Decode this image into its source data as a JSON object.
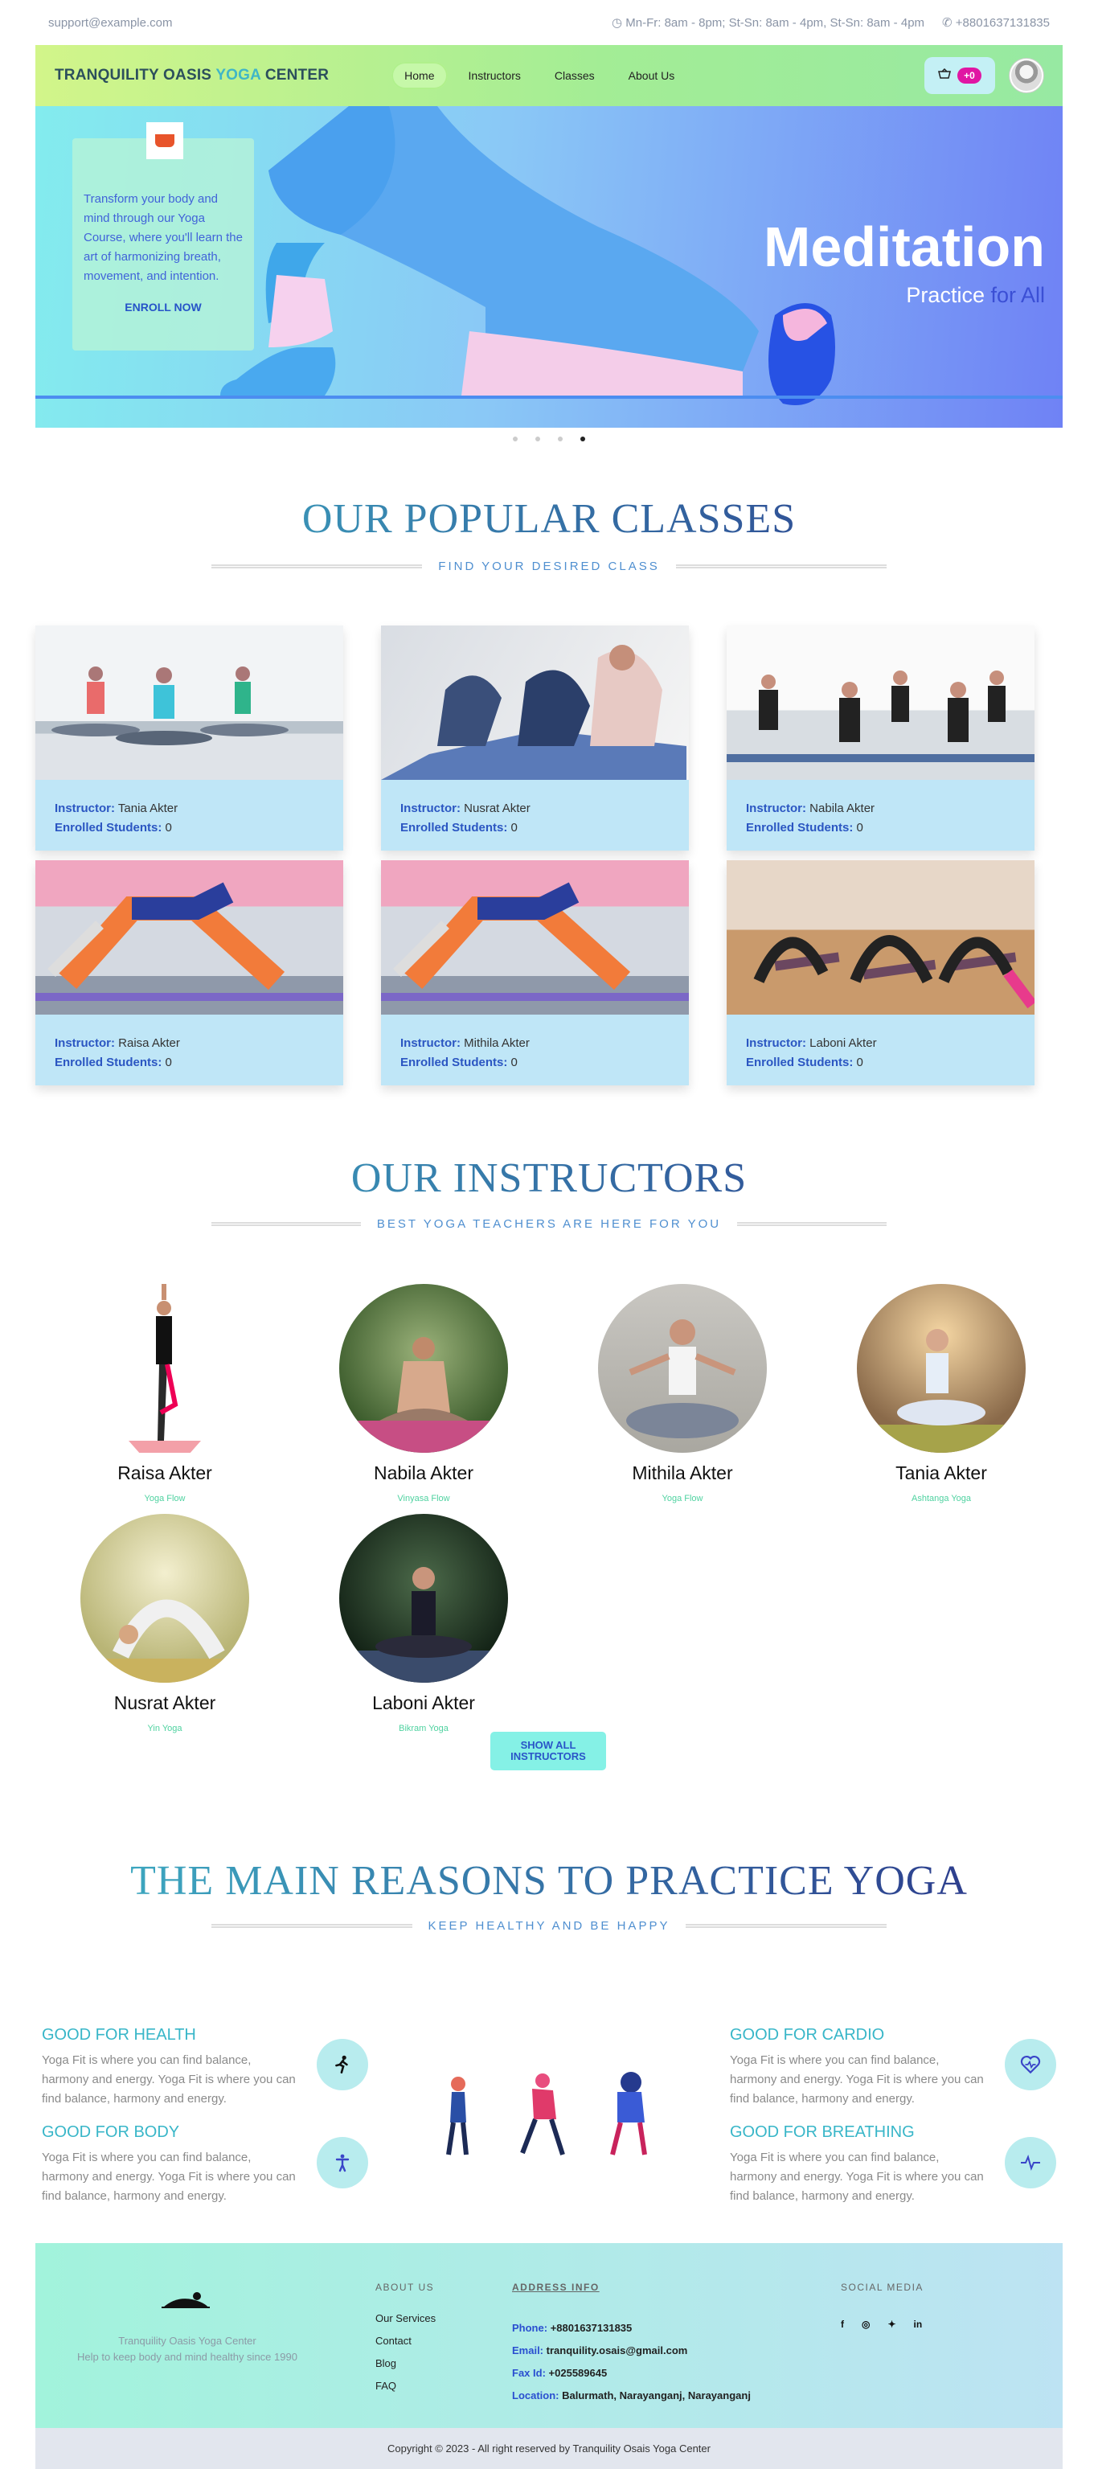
{
  "topbar": {
    "email": "support@example.com",
    "hours": "Mn-Fr: 8am - 8pm; St-Sn: 8am - 4pm, St-Sn: 8am - 4pm",
    "phone": "+8801637131835"
  },
  "nav": {
    "brand_1": "TRANQUILITY OASIS ",
    "brand_2": "YOGA",
    "brand_3": " CENTER",
    "items": [
      "Home",
      "Instructors",
      "Classes",
      "About Us"
    ],
    "cart_count": "+0"
  },
  "hero": {
    "text": "Transform your body and mind through our Yoga Course, where you'll learn the art of harmonizing breath, movement, and intention.",
    "cta": "ENROLL NOW",
    "title": "Meditation",
    "sub1": "Practice ",
    "sub2": "for All"
  },
  "classes": {
    "title": "OUR POPULAR CLASSES",
    "subtitle": "FIND YOUR DESIRED CLASS",
    "instructor_label": "Instructor:",
    "enrolled_label": "Enrolled Students:",
    "items": [
      {
        "instructor": "Tania Akter",
        "enrolled": "0"
      },
      {
        "instructor": "Nusrat Akter",
        "enrolled": "0"
      },
      {
        "instructor": "Nabila Akter",
        "enrolled": "0"
      },
      {
        "instructor": "Raisa Akter",
        "enrolled": "0"
      },
      {
        "instructor": "Mithila Akter",
        "enrolled": "0"
      },
      {
        "instructor": "Laboni Akter",
        "enrolled": "0"
      }
    ]
  },
  "instructors": {
    "title": "OUR INSTRUCTORS",
    "subtitle": "BEST YOGA TEACHERS ARE HERE FOR YOU",
    "show_all": "SHOW ALL INSTRUCTORS",
    "items": [
      {
        "name": "Raisa Akter",
        "style": "Yoga Flow"
      },
      {
        "name": "Nabila Akter",
        "style": "Vinyasa Flow"
      },
      {
        "name": "Mithila Akter",
        "style": "Yoga Flow"
      },
      {
        "name": "Tania Akter",
        "style": "Ashtanga Yoga"
      },
      {
        "name": "Nusrat Akter",
        "style": "Yin Yoga"
      },
      {
        "name": "Laboni Akter",
        "style": "Bikram Yoga"
      }
    ]
  },
  "reasons": {
    "title": "THE MAIN REASONS TO PRACTICE YOGA",
    "subtitle": "KEEP HEALTHY AND BE HAPPY",
    "items": [
      {
        "title": "GOOD FOR HEALTH",
        "text": "Yoga Fit is where you can find balance, harmony and energy. Yoga Fit is where you can find balance, harmony and energy."
      },
      {
        "title": "GOOD FOR BODY",
        "text": "Yoga Fit is where you can find balance, harmony and energy. Yoga Fit is where you can find balance, harmony and energy."
      },
      {
        "title": "GOOD FOR CARDIO",
        "text": "Yoga Fit is where you can find balance, harmony and energy. Yoga Fit is where you can find balance, harmony and energy."
      },
      {
        "title": "GOOD FOR BREATHING",
        "text": "Yoga Fit is where you can find balance, harmony and energy. Yoga Fit is where you can find balance, harmony and energy."
      }
    ]
  },
  "footer": {
    "org": "Tranquility Oasis Yoga Center",
    "tagline": "Help to keep body and mind healthy since 1990",
    "about_title": "ABOUT US",
    "about_links": [
      "Our Services",
      "Contact",
      "Blog",
      "FAQ"
    ],
    "address_title": "ADDRESS INFO",
    "phone_label": "Phone:",
    "phone": "+8801637131835",
    "email_label": "Email:",
    "email": "tranquility.osais@gmail.com",
    "fax_label": "Fax Id:",
    "fax": "+025589645",
    "location_label": "Location:",
    "location": "Balurmath, Narayanganj, Narayanganj",
    "social_title": "SOCIAL MEDIA",
    "copyright": "Copyright © 2023 - All right reserved by Tranquility Osais Yoga Center"
  }
}
